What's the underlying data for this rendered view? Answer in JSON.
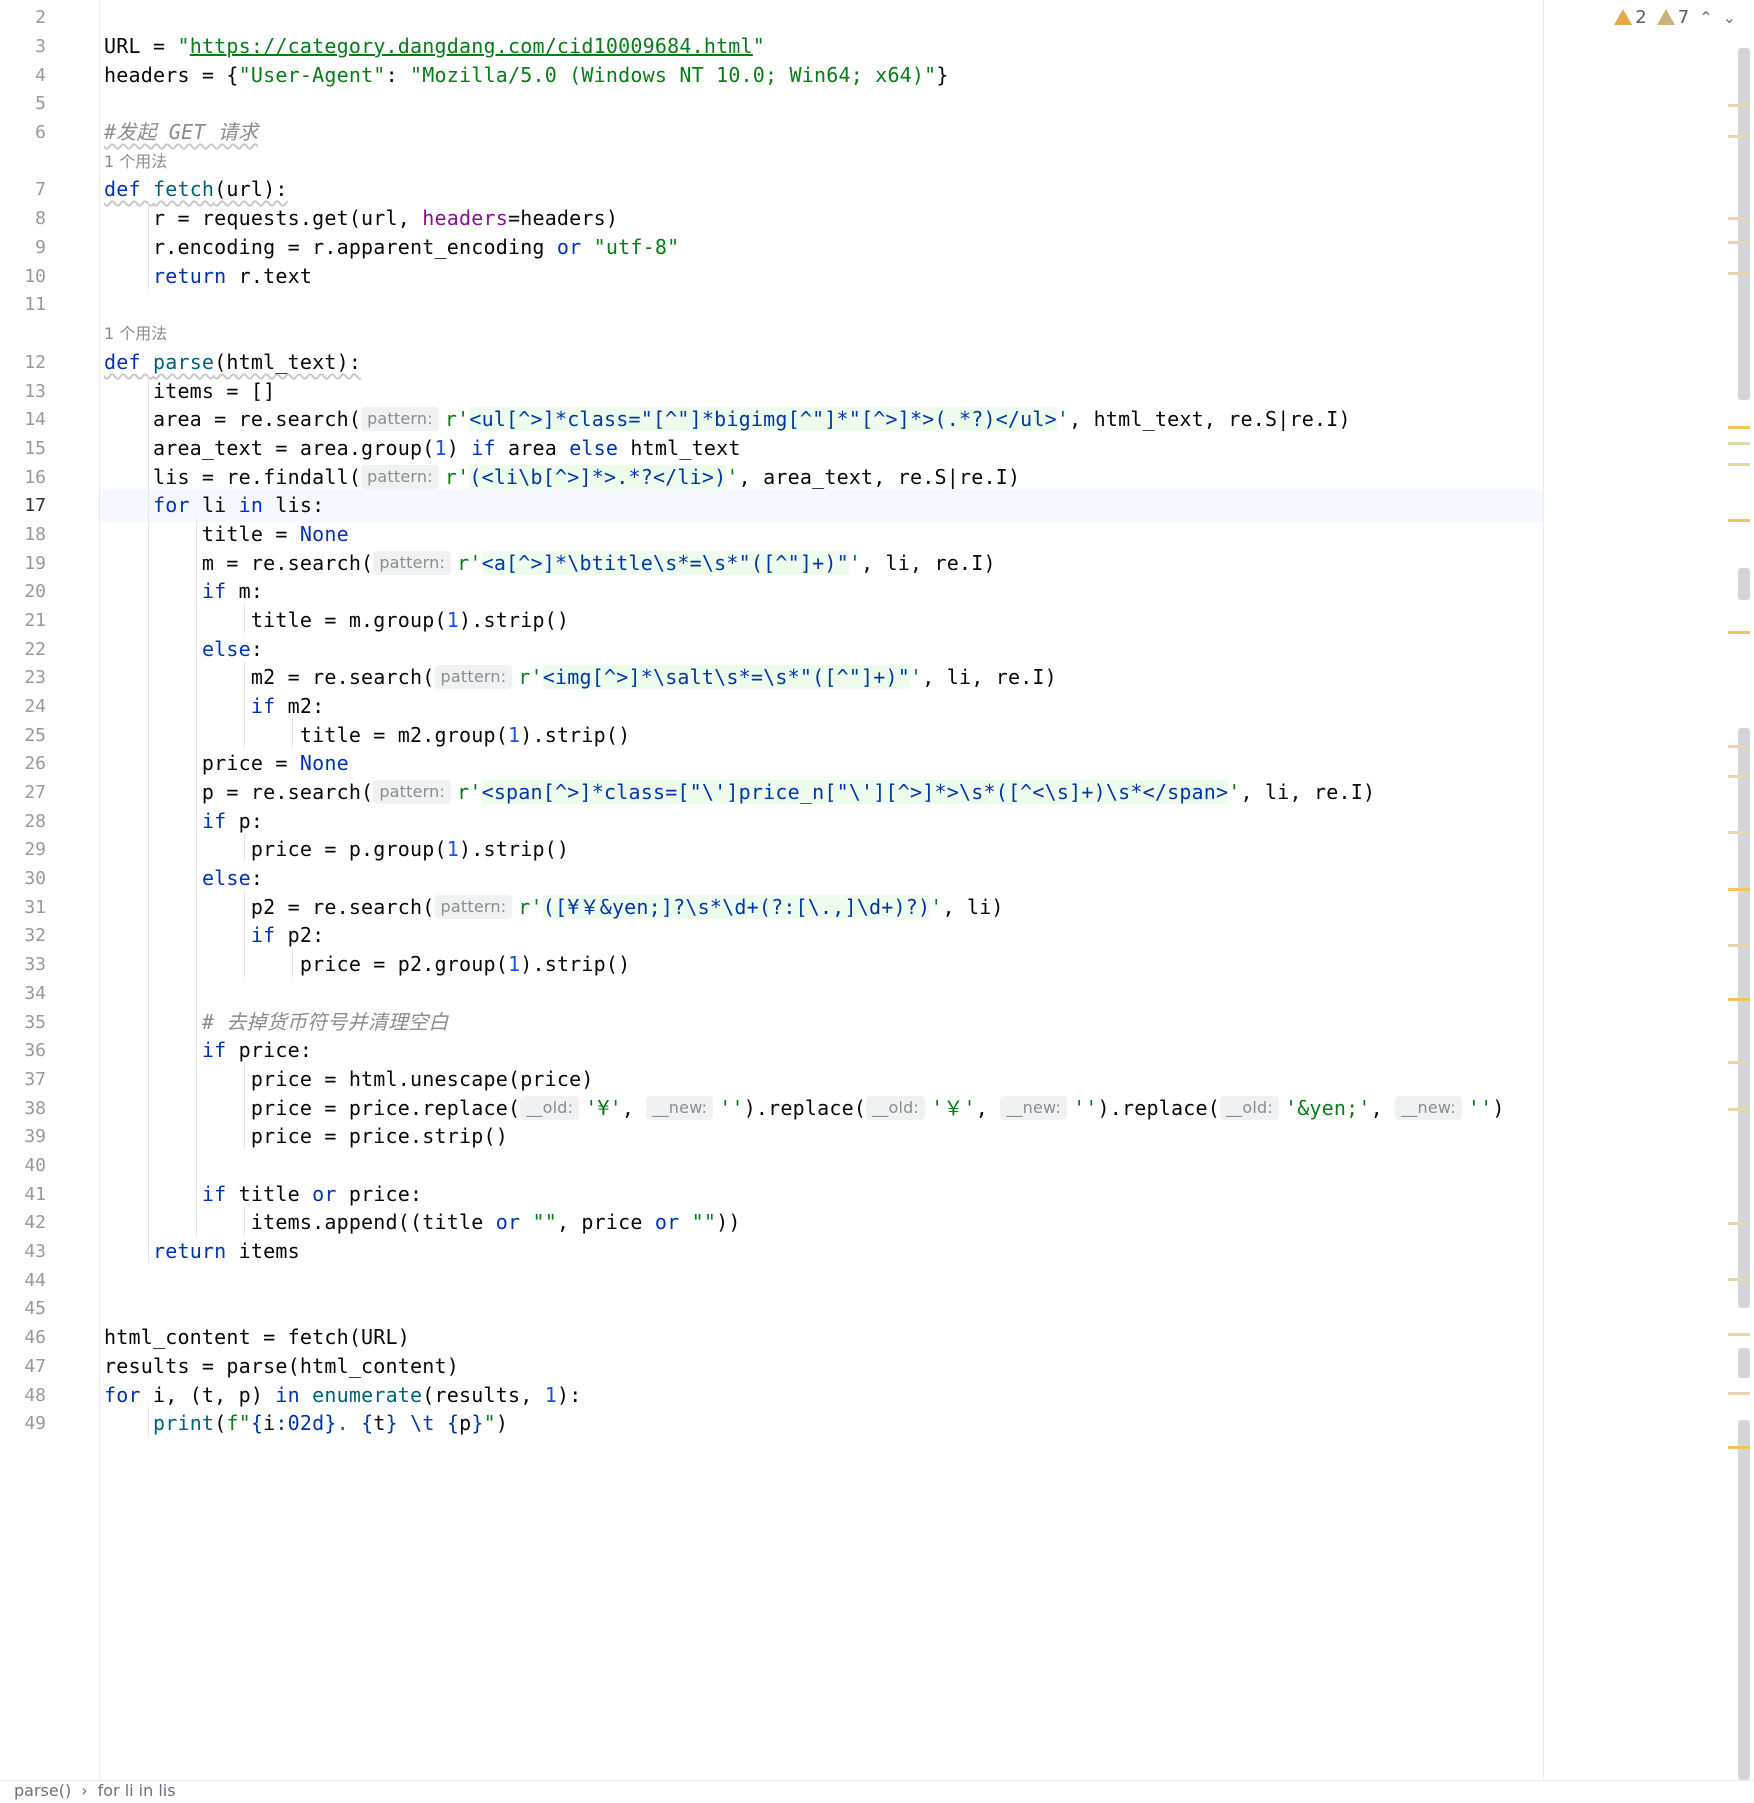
{
  "inspection": {
    "warnings_a": "2",
    "warnings_b": "7",
    "up_label": "⌃",
    "down_label": "⌄"
  },
  "usage_hint": "1 个用法",
  "param_hints": {
    "pattern": "pattern:",
    "old": "__old:",
    "new": "__new:"
  },
  "breadcrumb": {
    "item1": "parse()",
    "sep": "›",
    "item2": "for li in lis"
  },
  "code": {
    "url_var": "URL = ",
    "url": "https://category.dangdang.com/cid10009684.html",
    "headers_pre": "headers = {",
    "headers_key": "\"User-Agent\"",
    "headers_val": "\"Mozilla/5.0 (Windows NT 10.0; Win64; x64)\"",
    "cmt6": "#发起 GET 请求",
    "cmt35": "# 去掉货币符号并清理空白",
    "fetch_name": "fetch",
    "parse_name": "parse",
    "re14": "<ul[^>]*class=\"[^\"]*bigimg[^\"]*\"[^>]*>(.*?)</ul>",
    "re16": "(<li\\b[^>]*>.*?</li>)",
    "re19": "<a[^>]*\\btitle\\s*=\\s*\"([^\"]+)\"",
    "re23": "<img[^>]*\\salt\\s*=\\s*\"([^\"]+)\"",
    "re27": "<span[^>]*class=[\"\\']price_n[\"\\'][^>]*>\\s*([^<\\s]+)\\s*</span>",
    "re31": "([¥￥&yen;]?\\s*\\d+(?:[\\.,]\\d+)?)"
  }
}
